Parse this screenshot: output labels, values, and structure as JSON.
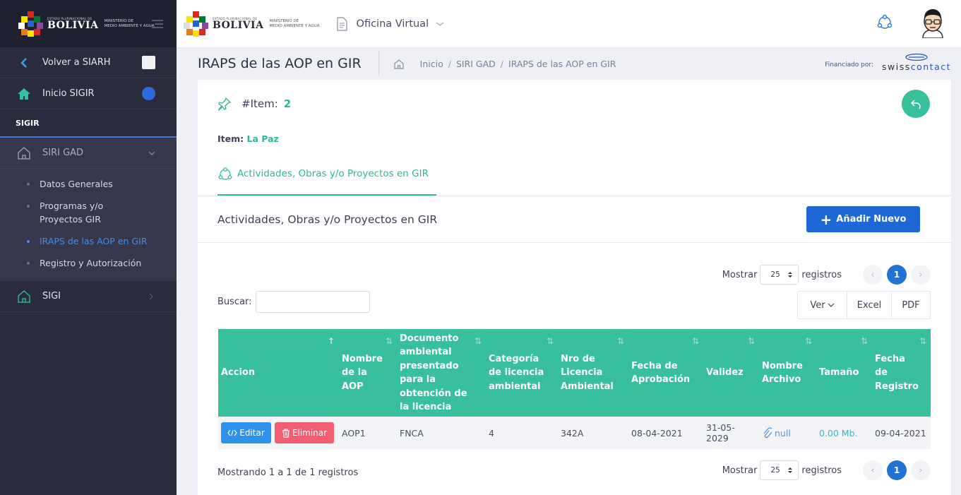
{
  "sidebar": {
    "back_label": "Volver a SIARH",
    "home_label": "Inicio SIGIR",
    "section_label": "SIGIR",
    "group_label": "SIRI GAD",
    "sub_items": [
      {
        "label": "Datos Generales"
      },
      {
        "label": "Programas y/o Proyectos GIR"
      },
      {
        "label": "IRAPS de las AOP en GIR",
        "active": true
      },
      {
        "label": "Registro y Autorización"
      }
    ],
    "sigi_label": "SIGI"
  },
  "logo": {
    "small": "ESTADO PLURINACIONAL DE",
    "big": "BOLIVIA",
    "ministry_line1": "MINISTERIO DE",
    "ministry_line2": "MEDIO AMBIENTE Y AGUA"
  },
  "topbar": {
    "app_menu_label": "Oficina Virtual"
  },
  "subheader": {
    "title": "IRAPS de las AOP en GIR",
    "breadcrumbs": [
      "Inicio",
      "SIRI GAD",
      "IRAPS de las AOP en GIR"
    ],
    "financed_label": "Financiado por:",
    "sponsor_prefix": "swiss",
    "sponsor_suffix": "contact"
  },
  "item": {
    "label": "#Item:",
    "number": "2",
    "name_label": "Item:",
    "name_value": "La Paz"
  },
  "tab": {
    "label": "Actividades, Obras y/o Proyectos en GIR"
  },
  "section": {
    "title": "Actividades, Obras y/o Proyectos en GIR",
    "add_button": "Añadir Nuevo"
  },
  "controls": {
    "show_label": "Mostrar",
    "page_size": "25",
    "records_label": "registros",
    "current_page": "1",
    "search_label": "Buscar:",
    "search_value": "",
    "view_button": "Ver",
    "excel_button": "Excel",
    "pdf_button": "PDF"
  },
  "table": {
    "headers": {
      "accion": "Accion",
      "nombre": "Nombre de la AOP",
      "documento": "Documento ambiental presentado para la obtención de la licencia",
      "categoria": "Categoría de licencia ambiental",
      "nro": "Nro de Licencia Ambiental",
      "fecha_aprob": "Fecha de Aprobación",
      "validez": "Validez",
      "archivo": "Nombre Archivo",
      "tamano": "Tamaño",
      "fecha_reg": "Fecha de Registro"
    },
    "rows": [
      {
        "edit_label": "Editar",
        "delete_label": "Eliminar",
        "nombre": "AOP1",
        "documento": "FNCA",
        "categoria": "4",
        "nro": "342A",
        "fecha_aprob": "08-04-2021",
        "validez": "31-05-2029",
        "archivo": "null",
        "tamano": "0.00 Mb.",
        "fecha_reg": "09-04-2021"
      }
    ]
  },
  "footer": {
    "info": "Mostrando 1 a 1 de 1 registros"
  },
  "colors": {
    "accent": "#38bf9c",
    "primary": "#1e68d6",
    "danger": "#f35d6f",
    "sidebar": "#2a2b3d"
  }
}
